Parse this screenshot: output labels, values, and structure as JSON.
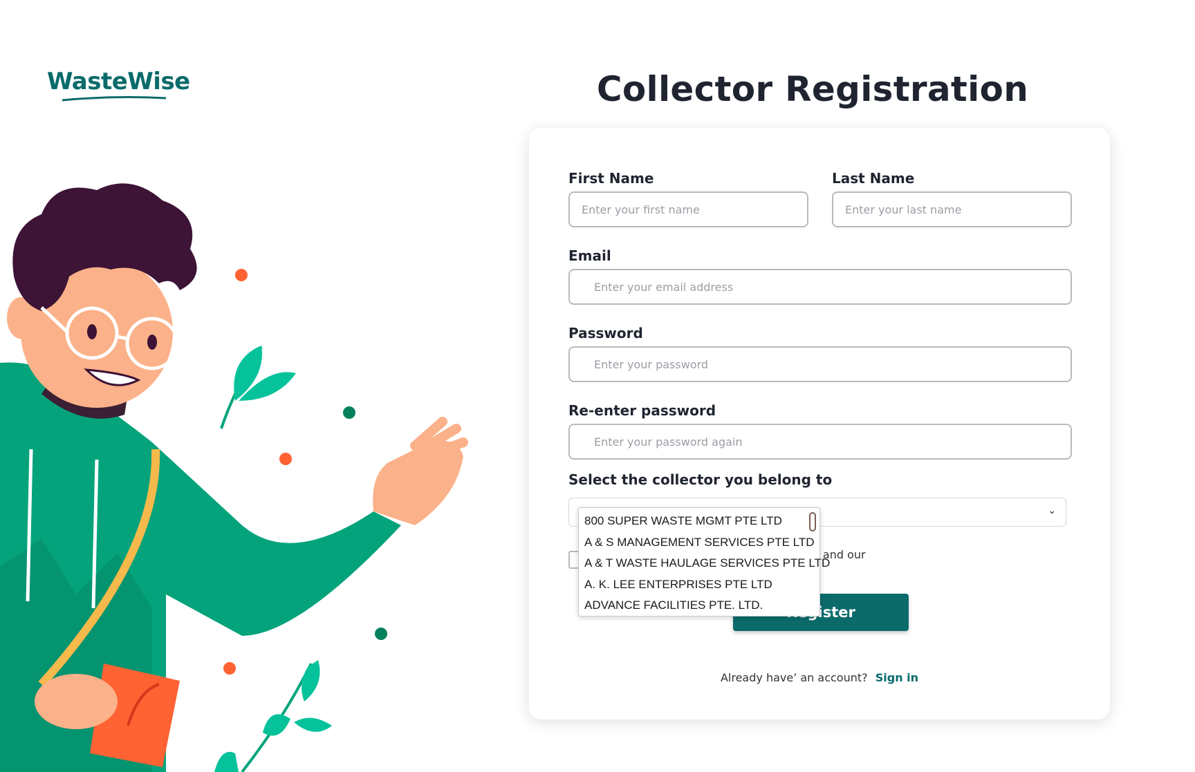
{
  "brand": {
    "logo_text": "WasteWise"
  },
  "page": {
    "title": "Collector Registration"
  },
  "form": {
    "first_name": {
      "label": "First Name",
      "placeholder": "Enter your first name"
    },
    "last_name": {
      "label": "Last Name",
      "placeholder": "Enter your last name"
    },
    "email": {
      "label": "Email",
      "placeholder": "Enter your email address"
    },
    "password": {
      "label": "Password",
      "placeholder": "Enter your password"
    },
    "reenter_password": {
      "label": "Re-enter password",
      "placeholder": "Enter your password again"
    },
    "collector": {
      "label": "Select the collector you belong to",
      "options": [
        "800 SUPER WASTE MGMT PTE LTD",
        "A & S MANAGEMENT SERVICES PTE LTD",
        "A & T WASTE HAULAGE SERVICES PTE LTD",
        "A. K. LEE ENTERPRISES PTE LTD",
        "ADVANCE FACILITIES PTE. LTD."
      ]
    },
    "terms_text_visible": "e and our",
    "register_label": "Register"
  },
  "signin": {
    "prompt": "Already have’ an account?",
    "link": "Sign in"
  },
  "colors": {
    "brand": "#0b6b6b",
    "accent_green": "#05a37c",
    "accent_orange": "#ff6233"
  }
}
